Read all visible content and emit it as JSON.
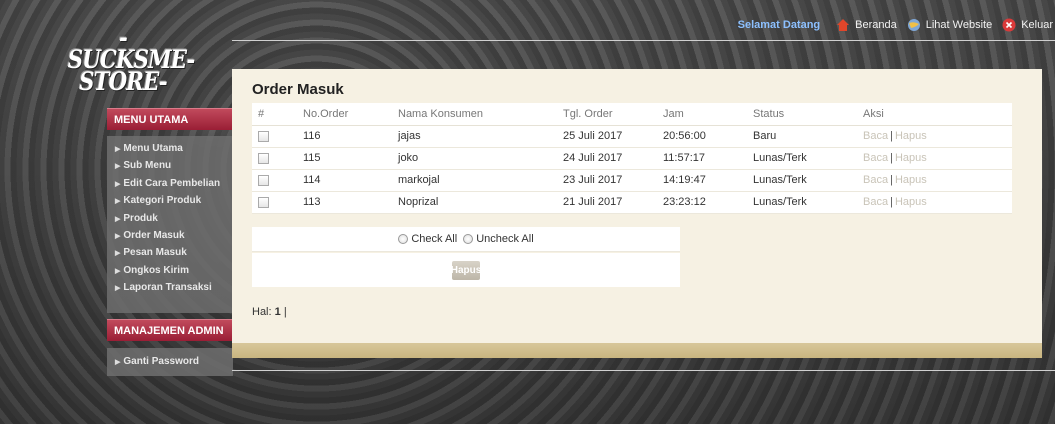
{
  "logo": {
    "line1": "-SUCKSME-",
    "line2": "STORE-"
  },
  "sidebar": {
    "main_heading": "MENU UTAMA",
    "main_items": [
      {
        "label": "Menu Utama"
      },
      {
        "label": "Sub Menu"
      },
      {
        "label": "Edit Cara Pembelian"
      },
      {
        "label": "Kategori Produk"
      },
      {
        "label": "Produk"
      },
      {
        "label": "Order Masuk"
      },
      {
        "label": "Pesan Masuk"
      },
      {
        "label": "Ongkos Kirim"
      },
      {
        "label": "Laporan Transaksi"
      }
    ],
    "admin_heading": "MANAJEMEN ADMIN",
    "admin_items": [
      {
        "label": "Ganti Password"
      }
    ]
  },
  "topbar": {
    "welcome": "Selamat Datang",
    "beranda": "Beranda",
    "lihat_website": "Lihat Website",
    "keluar": "Keluar"
  },
  "main": {
    "title": "Order Masuk",
    "columns": [
      "#",
      "No.Order",
      "Nama Konsumen",
      "Tgl. Order",
      "Jam",
      "Status",
      "Aksi"
    ],
    "rows": [
      {
        "no": "116",
        "nama": "jajas",
        "tgl": "25 Juli 2017",
        "jam": "20:56:00",
        "status": "Baru",
        "baca": "Baca",
        "sep": "|",
        "hapus": "Hapus"
      },
      {
        "no": "115",
        "nama": "joko",
        "tgl": "24 Juli 2017",
        "jam": "11:57:17",
        "status": "Lunas/Terk",
        "baca": "Baca",
        "sep": "|",
        "hapus": "Hapus"
      },
      {
        "no": "114",
        "nama": "markojal",
        "tgl": "23 Juli 2017",
        "jam": "14:19:47",
        "status": "Lunas/Terk",
        "baca": "Baca",
        "sep": "|",
        "hapus": "Hapus"
      },
      {
        "no": "113",
        "nama": "Noprizal",
        "tgl": "21 Juli 2017",
        "jam": "23:23:12",
        "status": "Lunas/Terk",
        "baca": "Baca",
        "sep": "|",
        "hapus": "Hapus"
      }
    ],
    "check_all": "Check All",
    "uncheck_all": "Uncheck All",
    "hapus_button": "Hapus",
    "paging_label": "Hal:",
    "paging_current": "1",
    "paging_sep": "|"
  },
  "colors": {
    "menu_heading": "#9a1e35",
    "panel_bg": "#f6f1e3",
    "panel_footer": "#c9b580",
    "welcome_text": "#8cc0ff"
  }
}
